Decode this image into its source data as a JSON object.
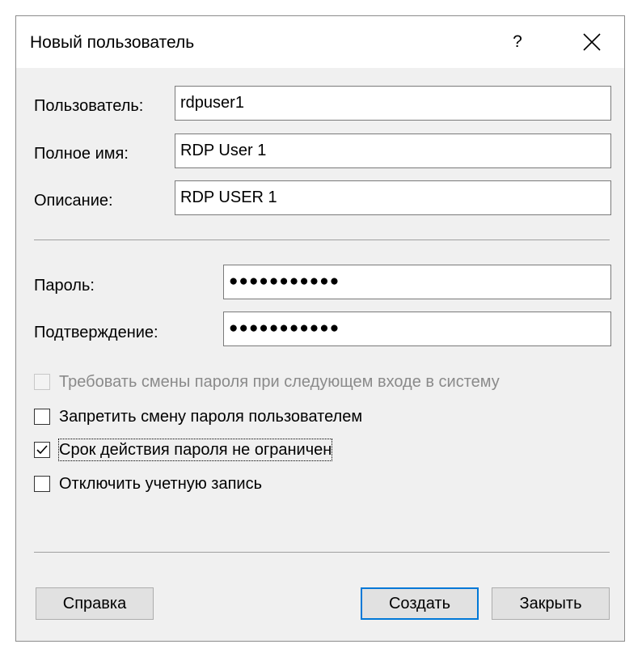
{
  "window": {
    "title": "Новый пользователь",
    "help_label": "?"
  },
  "fields": {
    "username_label": "Пользователь:",
    "username_value": "rdpuser1",
    "fullname_label": "Полное имя:",
    "fullname_value": "RDP User 1",
    "description_label": "Описание:",
    "description_value": "RDP USER 1",
    "password_label": "Пароль:",
    "password_value": "●●●●●●●●●●●",
    "confirm_label": "Подтверждение:",
    "confirm_value": "●●●●●●●●●●●"
  },
  "options": [
    {
      "label": "Требовать смены пароля при следующем входе в систему",
      "checked": false,
      "enabled": false
    },
    {
      "label": "Запретить смену пароля пользователем",
      "checked": false,
      "enabled": true
    },
    {
      "label": "Срок действия пароля не ограничен",
      "checked": true,
      "enabled": true,
      "focused": true
    },
    {
      "label": "Отключить учетную запись",
      "checked": false,
      "enabled": true
    }
  ],
  "buttons": {
    "help": "Справка",
    "create": "Создать",
    "close": "Закрыть"
  },
  "colors": {
    "default_button_border": "#0078d7",
    "dialog_background": "#f0f0f0"
  }
}
